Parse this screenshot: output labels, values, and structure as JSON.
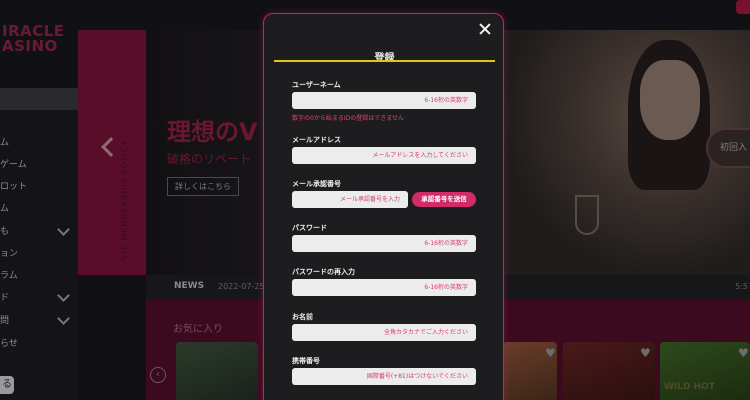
{
  "site": {
    "logo_line1": "IRACLE",
    "logo_line2": "ASINO",
    "sidebar_items": [
      {
        "label": "ム",
        "chevron": false
      },
      {
        "label": "ゲーム",
        "chevron": false
      },
      {
        "label": "ロット",
        "chevron": false
      },
      {
        "label": "ム",
        "chevron": false
      },
      {
        "label": "も",
        "chevron": true
      },
      {
        "label": "ョン",
        "chevron": false
      },
      {
        "label": "ラム",
        "chevron": false
      },
      {
        "label": "ド",
        "chevron": true
      },
      {
        "label": "問",
        "chevron": true
      },
      {
        "label": "らせ",
        "chevron": false
      }
    ],
    "sidebar_bottom_icon": "る"
  },
  "banner": {
    "vertical_text": "VIP MEMBERSHIP POLICY",
    "title": "理想のV",
    "subtitle": "破格のリベート",
    "details_button": "詳しくはこちら",
    "side_badge": "初回入"
  },
  "news": {
    "label": "NEWS",
    "date": "2022-07-25",
    "right": "5:5"
  },
  "favorites": {
    "title": "お気に入り",
    "tile_label": "WILD HOT"
  },
  "modal": {
    "title": "登録",
    "username": {
      "label": "ユーザーネーム",
      "placeholder": "6-16桁の英数字",
      "error": "数字の0から始まるIDの登録はできません"
    },
    "email": {
      "label": "メールアドレス",
      "placeholder": "メールアドレスを入力してください"
    },
    "email_code": {
      "label": "メール承認番号",
      "placeholder": "メール承認番号を入力",
      "send_button": "承認番号を送信"
    },
    "password": {
      "label": "パスワード",
      "placeholder": "6-16桁の英数字"
    },
    "password_confirm": {
      "label": "パスワードの再入力",
      "placeholder": "6-16桁の英数字"
    },
    "name": {
      "label": "お名前",
      "placeholder": "全角カタカナでご入力ください"
    },
    "phone": {
      "label": "携帯番号",
      "placeholder": "国際番号(+81)はつけないでください"
    }
  },
  "colors": {
    "accent": "#d22b68",
    "underline": "#e7c117",
    "modal_bg": "#1d1d1f"
  }
}
